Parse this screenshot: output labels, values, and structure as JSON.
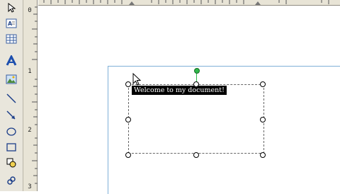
{
  "toolbar": {
    "tools": [
      {
        "name": "select-objects-icon"
      },
      {
        "name": "text-box-icon"
      },
      {
        "name": "table-frame-icon"
      },
      {
        "name": "wordart-icon"
      },
      {
        "name": "picture-frame-icon"
      },
      {
        "name": "line-icon"
      },
      {
        "name": "arrow-icon"
      },
      {
        "name": "oval-icon"
      },
      {
        "name": "rectangle-icon"
      },
      {
        "name": "autoshapes-icon"
      },
      {
        "name": "hot-spot-icon"
      }
    ]
  },
  "ruler": {
    "vertical_labels": [
      "0",
      "1",
      "2",
      "3"
    ]
  },
  "document": {
    "textbox_text": "Welcome to my document!"
  },
  "colors": {
    "toolbar_bg": "#e9e6dc",
    "ruler_bg": "#e8e4d6",
    "margin_guide": "#7fb0d8",
    "rotate_handle": "#2fb84a",
    "selection_text_bg": "#000000"
  }
}
